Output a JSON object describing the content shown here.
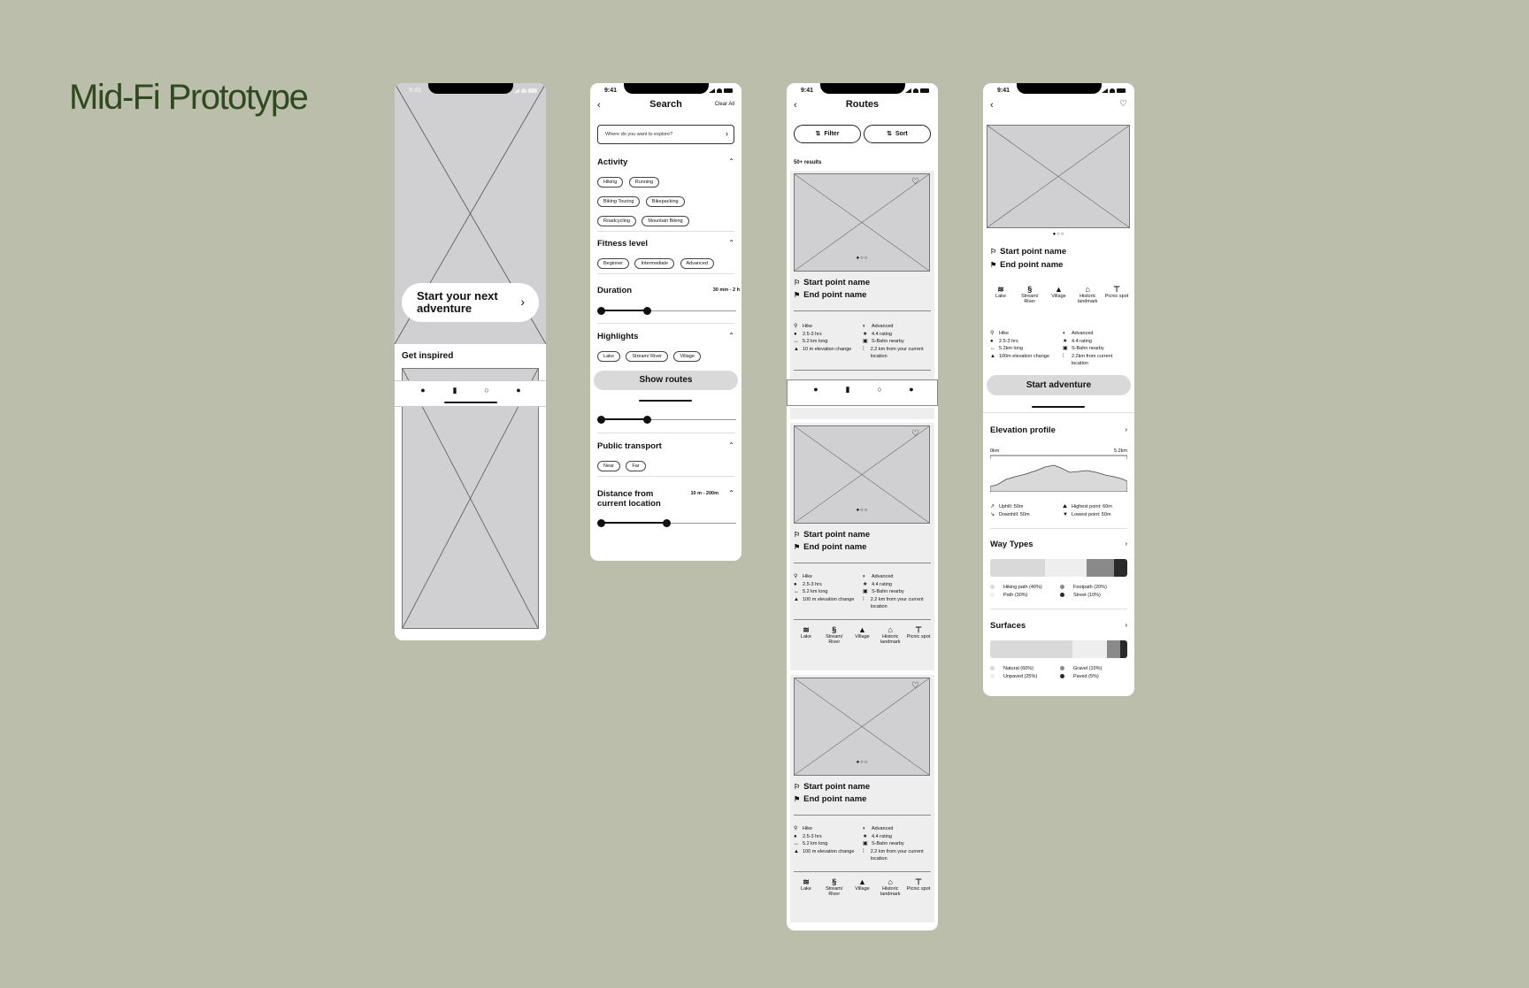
{
  "title": "Mid-Fi Prototype",
  "status_time": "9:41",
  "home": {
    "cta": "Start your next adventure",
    "section": "Get inspired"
  },
  "search": {
    "back": "<",
    "title": "Search",
    "clear": "Clear All",
    "placeholder": "Where do you want to explore?",
    "activity": {
      "title": "Activity",
      "chips": [
        "Hiking",
        "Running",
        "Biking Touring",
        "Bikepacking",
        "Roadcycling",
        "Mountain Biking"
      ]
    },
    "fitness": {
      "title": "Fitness level",
      "chips": [
        "Beginner",
        "Intermediate",
        "Advanced"
      ]
    },
    "duration": {
      "title": "Duration",
      "range": "30 min - 2 h"
    },
    "highlights": {
      "title": "Highlights",
      "chips": [
        "Lake",
        "Stream/ River",
        "Village"
      ]
    },
    "show_routes": "Show routes",
    "transport": {
      "title": "Public transport",
      "chips": [
        "Near",
        "Far"
      ]
    },
    "distance": {
      "title": "Distance from current location",
      "range": "10 m - 200m"
    }
  },
  "routes": {
    "title": "Routes",
    "filter": "Filter",
    "sort": "Sort",
    "results": "50+ results",
    "start": "Start point name",
    "end": "End point name",
    "attrs_left": [
      "Hike",
      "2.5-3 hrs",
      "5.2 km long",
      "10 m elevation change"
    ],
    "attrs_left_b": [
      "Hike",
      "2.5-3 hrs",
      "5.2 km long",
      "100 m elevation change"
    ],
    "attrs_right": [
      "Advanced",
      "4.4 rating",
      "S-Bahn nearby",
      "2.2 km from your current location"
    ],
    "amenities": [
      "Lake",
      "Stream/ River",
      "Village",
      "Historic landmark",
      "Picnic spot"
    ]
  },
  "detail": {
    "start": "Start point name",
    "end": "End point name",
    "amenities": [
      "Lake",
      "Stream/ River",
      "Village",
      "Historic landmark",
      "Picnic spot"
    ],
    "attrs_left": [
      "Hike",
      "2.5-3 hrs",
      "5.2km long",
      "100m elevation change"
    ],
    "attrs_right": [
      "Advanced",
      "4.4 rating",
      "S-Bahn nearby",
      "2.2km from current location"
    ],
    "start_btn": "Start adventure",
    "elevation": {
      "title": "Elevation profile",
      "from": "0km",
      "to": "5.2km",
      "stats": [
        "Uphill: 50m",
        "Highest point: 60m",
        "Downhill: 50m",
        "Lowest point: 50m"
      ]
    },
    "way_types": {
      "title": "Way Types",
      "legend": [
        "Hiking path (40%)",
        "Footpath (20%)",
        "Path (30%)",
        "Street (10%)"
      ],
      "shares": [
        40,
        30,
        20,
        10
      ],
      "colors": [
        "#d9d9d9",
        "#eeeeee",
        "#8a8a8a",
        "#2a2a2a"
      ]
    },
    "surfaces": {
      "title": "Surfaces",
      "legend": [
        "Natural (60%)",
        "Gravel (10%)",
        "Unpaved (25%)",
        "Paved (5%)"
      ],
      "shares": [
        60,
        25,
        10,
        5
      ],
      "colors": [
        "#d9d9d9",
        "#eeeeee",
        "#8a8a8a",
        "#2a2a2a"
      ]
    }
  }
}
